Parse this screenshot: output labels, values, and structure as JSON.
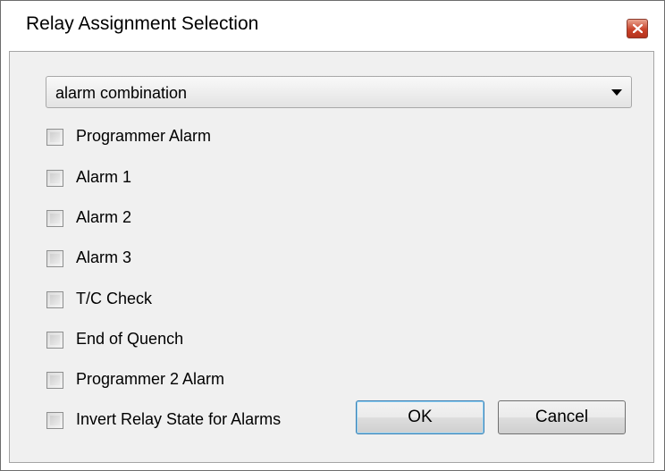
{
  "window": {
    "title": "Relay Assignment Selection"
  },
  "combo": {
    "value": "alarm combination"
  },
  "checkboxes": [
    {
      "label": "Programmer Alarm",
      "checked": false
    },
    {
      "label": "Alarm 1",
      "checked": false
    },
    {
      "label": "Alarm 2",
      "checked": false
    },
    {
      "label": "Alarm 3",
      "checked": false
    },
    {
      "label": "T/C Check",
      "checked": false
    },
    {
      "label": "End of Quench",
      "checked": false
    },
    {
      "label": "Programmer 2 Alarm",
      "checked": false
    },
    {
      "label": "Invert Relay State for Alarms",
      "checked": false
    }
  ],
  "buttons": {
    "ok_label": "OK",
    "cancel_label": "Cancel"
  },
  "icons": {
    "close": "close-icon",
    "dropdown": "chevron-down-icon"
  }
}
